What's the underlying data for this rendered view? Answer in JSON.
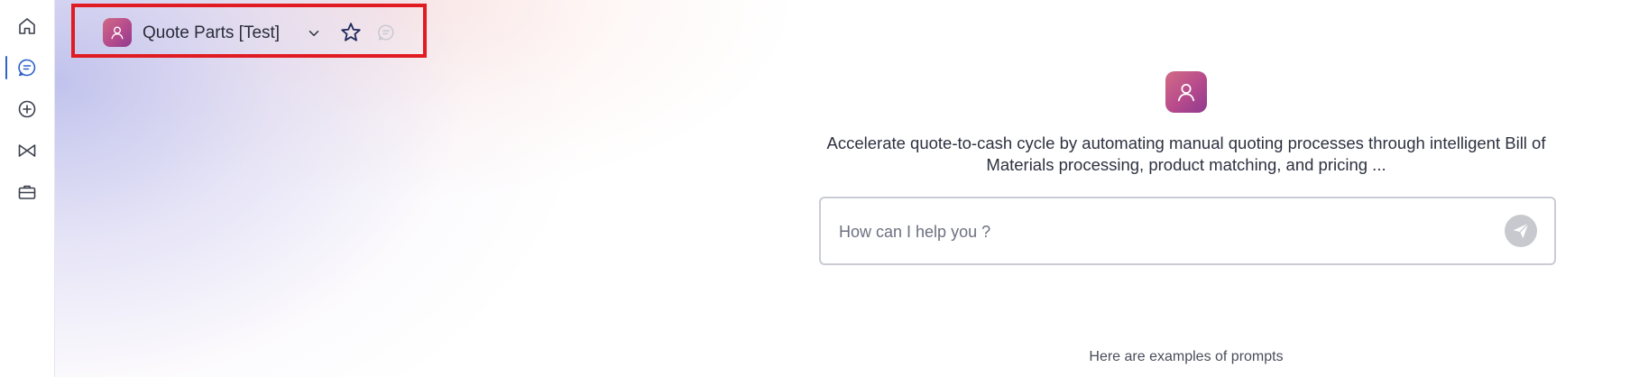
{
  "rail": {
    "items": [
      {
        "icon": "home-icon"
      },
      {
        "icon": "chat-icon",
        "active": true
      },
      {
        "icon": "add-circle-icon"
      },
      {
        "icon": "bowtie-icon"
      },
      {
        "icon": "briefcase-icon"
      }
    ],
    "accent_color": "#2f63c8"
  },
  "header": {
    "agent_name": "Quote Parts [Test]",
    "highlight_color": "#e01b22"
  },
  "center": {
    "description": "Accelerate quote-to-cash cycle by automating manual quoting processes through intelligent Bill of Materials processing, product matching, and pricing ...",
    "prompt_placeholder": "How can I help you ?",
    "examples_label": "Here are examples of prompts"
  },
  "colors": {
    "avatar_gradient_start": "#d06a86",
    "avatar_gradient_end": "#8f3a8f",
    "send_button": "#c8c9ce"
  }
}
